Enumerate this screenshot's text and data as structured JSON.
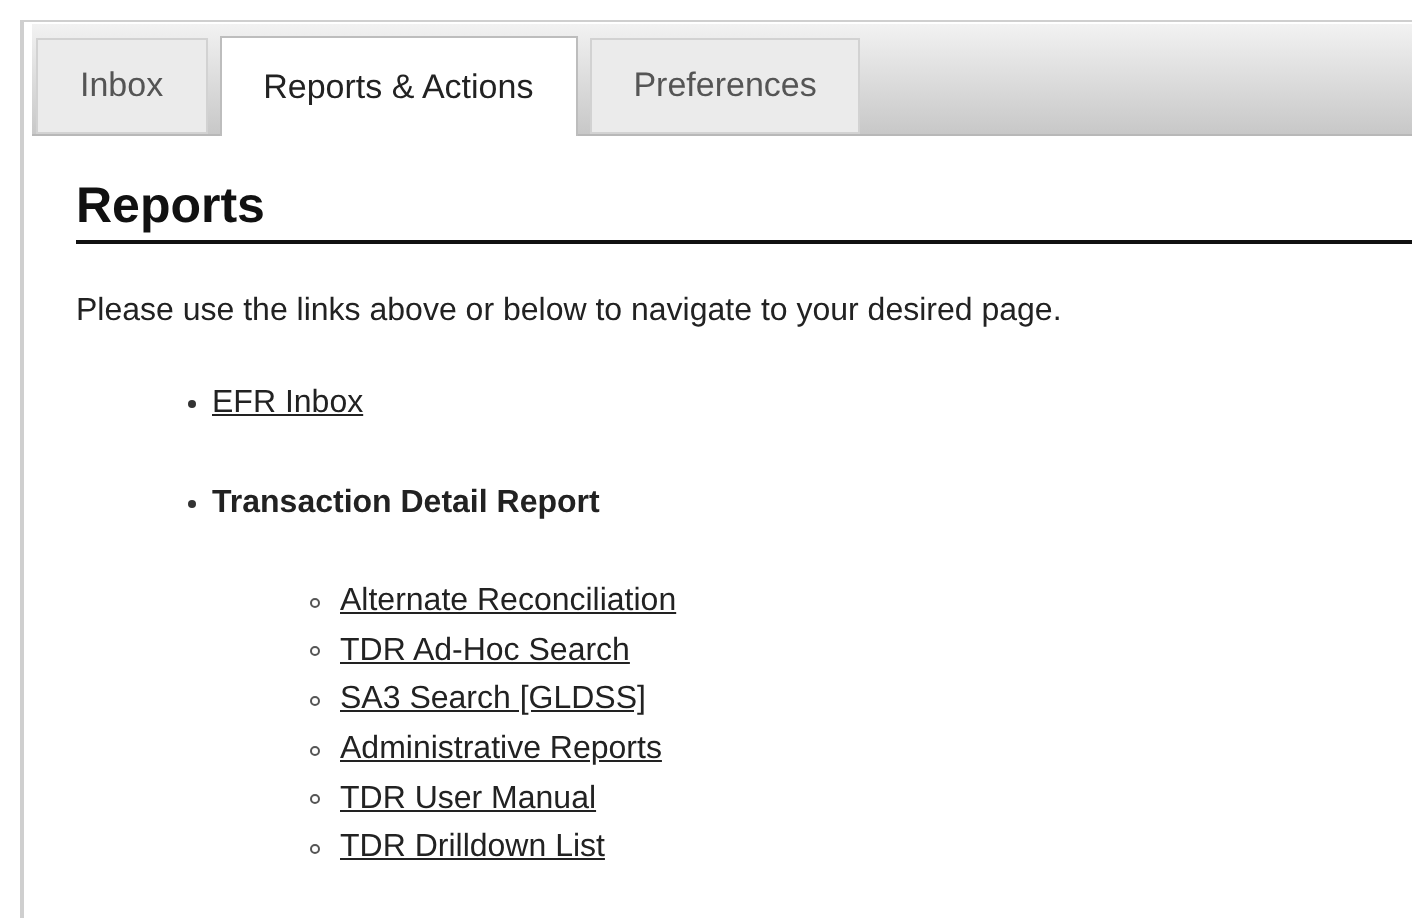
{
  "tabs": [
    {
      "label": "Inbox",
      "selected": false
    },
    {
      "label": "Reports & Actions",
      "selected": true
    },
    {
      "label": "Preferences",
      "selected": false
    }
  ],
  "heading": "Reports",
  "intro": "Please use the links above or below to navigate to your desired page.",
  "items": [
    {
      "kind": "link",
      "label": "EFR Inbox"
    },
    {
      "kind": "group",
      "label": "Transaction Detail Report",
      "children": [
        {
          "label": "Alternate Reconciliation"
        },
        {
          "label": "TDR Ad-Hoc Search"
        },
        {
          "label": "SA3 Search [GLDSS]"
        },
        {
          "label": "Administrative Reports"
        },
        {
          "label": "TDR User Manual"
        },
        {
          "label": "TDR Drilldown List"
        }
      ]
    }
  ]
}
